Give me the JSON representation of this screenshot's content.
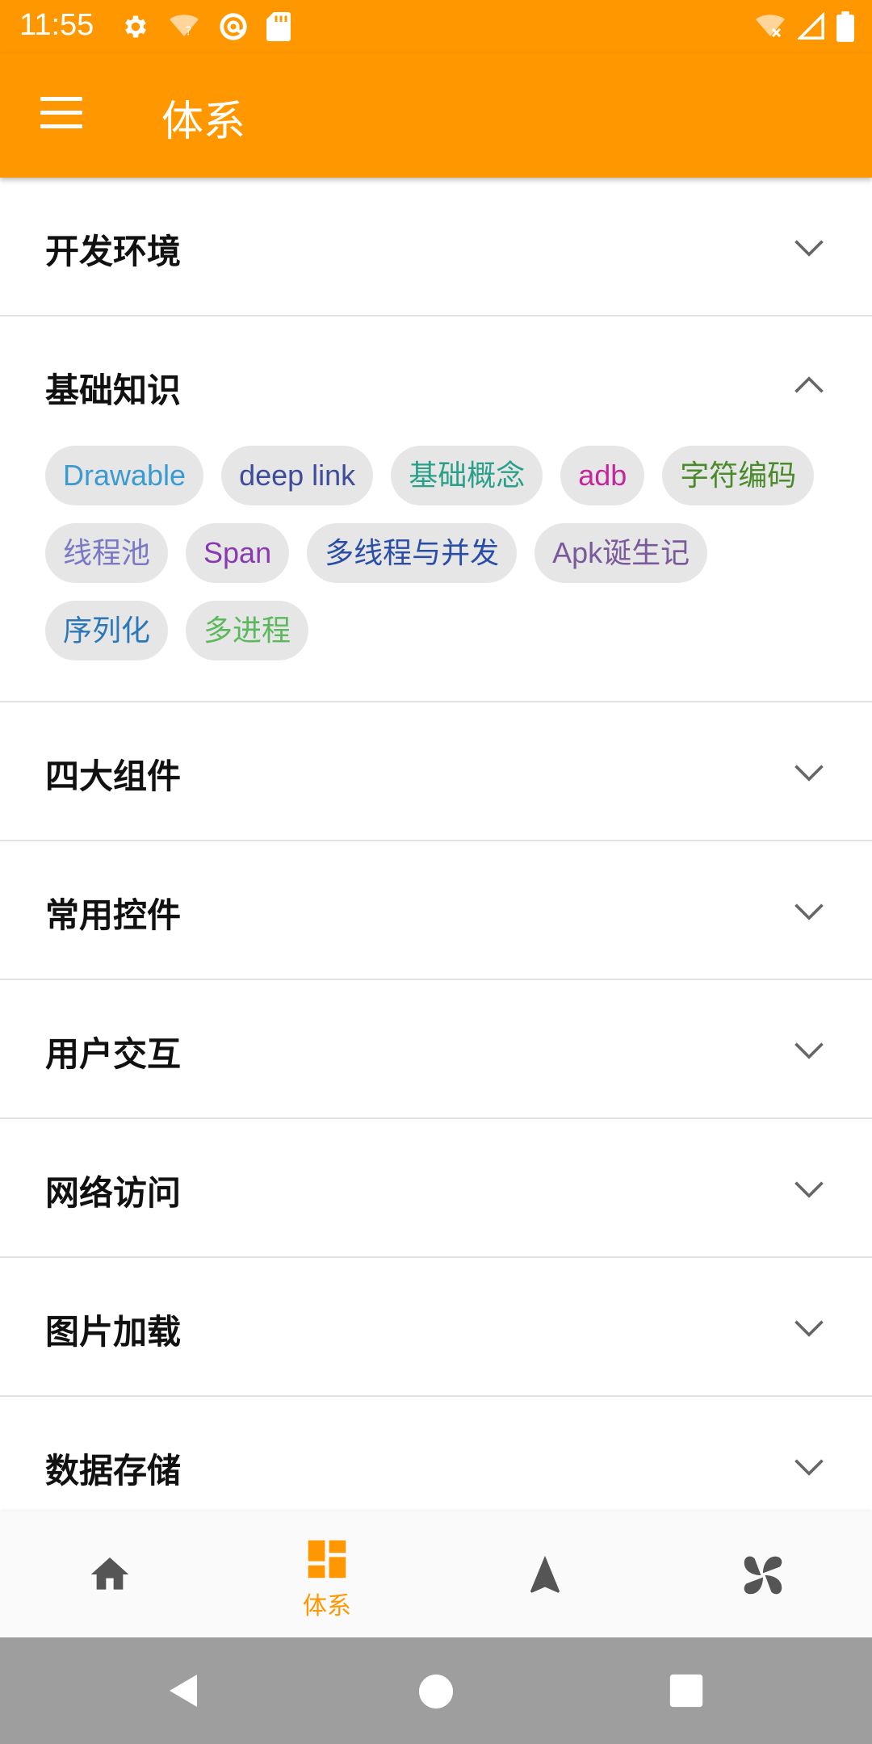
{
  "status_bar": {
    "time": "11:55",
    "icons_left": [
      "settings-icon",
      "wifi-question-icon",
      "at-sign-icon",
      "sd-card-icon"
    ],
    "icons_right": [
      "wifi-off-icon",
      "signal-icon",
      "battery-icon"
    ]
  },
  "app_bar": {
    "title": "体系",
    "menu_icon": "menu-icon"
  },
  "sections": [
    {
      "title": "开发环境",
      "expanded": false
    },
    {
      "title": "基础知识",
      "expanded": true,
      "chips": [
        {
          "label": "Drawable",
          "color": "#3a9bd0"
        },
        {
          "label": "deep link",
          "color": "#3f4c9a"
        },
        {
          "label": "基础概念",
          "color": "#2aa08a"
        },
        {
          "label": "adb",
          "color": "#c3279c"
        },
        {
          "label": "字符编码",
          "color": "#4a8a2a"
        },
        {
          "label": "线程池",
          "color": "#7a78c4"
        },
        {
          "label": "Span",
          "color": "#8a3ab0"
        },
        {
          "label": "多线程与并发",
          "color": "#2a4ea8"
        },
        {
          "label": "Apk诞生记",
          "color": "#7a5a9a"
        },
        {
          "label": "序列化",
          "color": "#2a78b8"
        },
        {
          "label": "多进程",
          "color": "#5cb85c"
        }
      ]
    },
    {
      "title": "四大组件",
      "expanded": false
    },
    {
      "title": "常用控件",
      "expanded": false
    },
    {
      "title": "用户交互",
      "expanded": false
    },
    {
      "title": "网络访问",
      "expanded": false
    },
    {
      "title": "图片加载",
      "expanded": false
    },
    {
      "title": "数据存储",
      "expanded": false
    }
  ],
  "bottom_nav": {
    "items": [
      {
        "icon": "home-icon",
        "label": "",
        "active": false
      },
      {
        "icon": "dashboard-icon",
        "label": "体系",
        "active": true
      },
      {
        "icon": "navigation-icon",
        "label": "",
        "active": false
      },
      {
        "icon": "pinwheel-icon",
        "label": "",
        "active": false
      }
    ],
    "active_color": "#ff9800",
    "inactive_color": "#555555"
  },
  "system_nav": {
    "buttons": [
      "back-icon",
      "home-circle-icon",
      "recents-icon"
    ]
  },
  "colors": {
    "primary": "#ff9800",
    "chip_background": "#e6e6e6",
    "divider": "#e2e2e2"
  }
}
